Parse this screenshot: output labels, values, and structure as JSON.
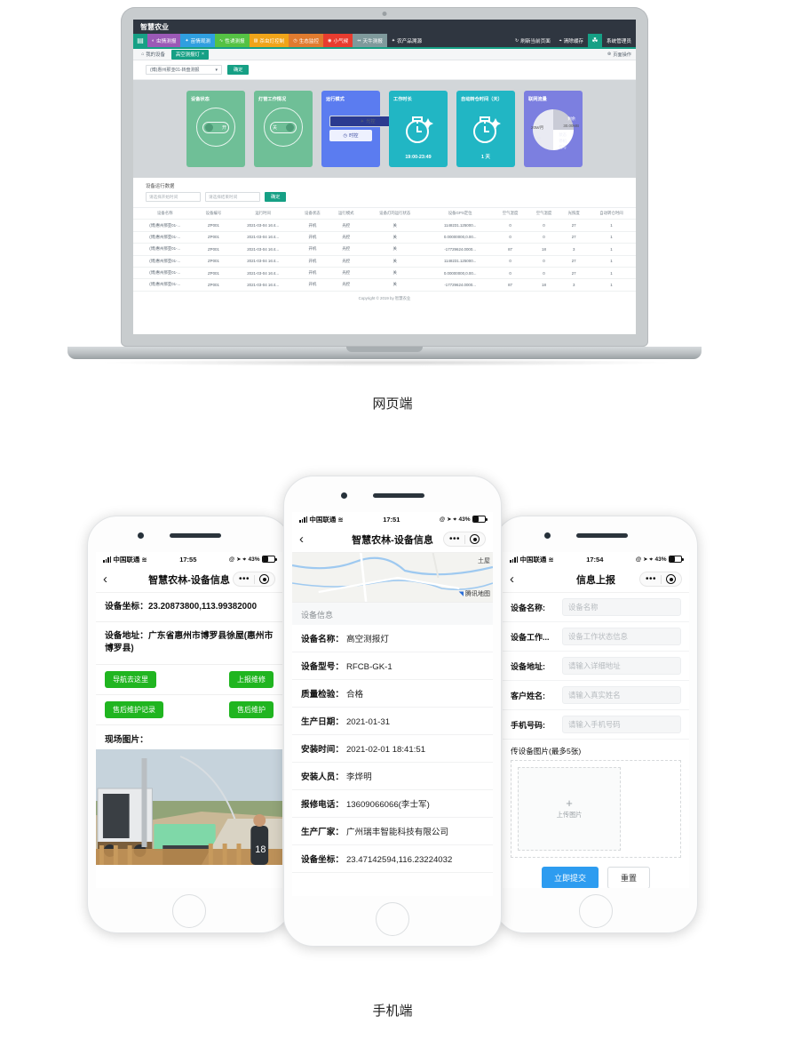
{
  "captions": {
    "web": "网页端",
    "mobile": "手机端"
  },
  "web": {
    "app_title": "智慧农业",
    "home_icon": "grid-icon",
    "nav_items": [
      {
        "label": "虫情测报",
        "icon": "bug-icon",
        "color": "#9b59b6"
      },
      {
        "label": "苗情观测",
        "icon": "leaf-icon",
        "color": "#2f9fe0"
      },
      {
        "label": "性诱测报",
        "icon": "wave-icon",
        "color": "#55c244"
      },
      {
        "label": "杀虫灯控制",
        "icon": "lamp-icon",
        "color": "#f0a419"
      },
      {
        "label": "生态监控",
        "icon": "clock-icon",
        "color": "#e07b2f"
      },
      {
        "label": "小气候",
        "icon": "target-icon",
        "color": "#e83c2f"
      },
      {
        "label": "天牛测报",
        "icon": "insect-icon",
        "color": "#7f9a9c"
      },
      {
        "label": "农产品溯源",
        "icon": "trace-icon",
        "color": "#2f3640"
      }
    ],
    "nav_right": [
      {
        "label": "刷新当前页面",
        "icon": "refresh-icon"
      },
      {
        "label": "清除缓存",
        "icon": "broom-icon"
      }
    ],
    "account": "系统管理员",
    "account_icon": "user-avatar-icon",
    "tabs": [
      {
        "label": "我的设备",
        "icon": "home-icon",
        "active": false,
        "closable": false
      },
      {
        "label": "高空测报灯",
        "icon": "",
        "active": true,
        "closable": true
      }
    ],
    "tab_right_label": "页面操作",
    "tab_right_icon": "settings-icon",
    "filter": {
      "select_value": "(博)惠州那亚01-转盘测报",
      "select_icon": "chevron-down-icon",
      "confirm_label": "确定"
    },
    "cards": [
      {
        "title": "设备状态",
        "type": "toggle",
        "state": "开",
        "color": "#6fbf97",
        "on": true
      },
      {
        "title": "灯管工作情况",
        "type": "toggle",
        "state": "关",
        "color": "#6fbf97",
        "on": false
      },
      {
        "title": "运行模式",
        "type": "mode",
        "color": "#5b7cf0",
        "options": [
          {
            "label": "光控",
            "icon": "sun-icon",
            "selected": true
          },
          {
            "label": "时控",
            "icon": "clock-icon",
            "selected": false
          }
        ]
      },
      {
        "title": "工作时长",
        "type": "clock",
        "color": "#21b6c4",
        "value": "19:00-23:49",
        "icon": "timer-icon"
      },
      {
        "title": "自动转仓时间（天）",
        "type": "clock",
        "color": "#21b6c4",
        "value": "1 天",
        "icon": "timer-icon"
      },
      {
        "title": "联网流量",
        "type": "pie",
        "color": "#7c7fe0",
        "slices": [
          {
            "label": "剩余",
            "value": "30.00MB"
          },
          {
            "label": "20M/月",
            "value": "40"
          },
          {
            "label": "状态",
            "value": "停机"
          },
          {
            "label": "信号",
            "value": ""
          }
        ]
      }
    ],
    "table_section_title": "设备运行数据",
    "date_from_placeholder": "请选择开始时间",
    "date_to_placeholder": "请选择结束时间",
    "date_confirm": "确定",
    "table": {
      "headers": [
        "设备名称",
        "设备编号",
        "运行时间",
        "设备状态",
        "运行模式",
        "设备灯的运行状态",
        "设备GPS定位",
        "空气湿度",
        "空气温度",
        "光照度",
        "自动转仓时间"
      ],
      "rows": [
        [
          "(博)惠州那亚01-...",
          "ZP001",
          "2021-03-04 16:4...",
          "开机",
          "光控",
          "关",
          "1148231.125000...",
          "0",
          "0",
          "27",
          "1"
        ],
        [
          "(博)惠州那亚01-...",
          "ZP001",
          "2021-03-04 16:4...",
          "开机",
          "光控",
          "关",
          "0.00000000,0.00...",
          "0",
          "0",
          "27",
          "1"
        ],
        [
          "(博)惠州那亚01-...",
          "ZP001",
          "2021-03-04 16:4...",
          "开机",
          "光控",
          "关",
          "-17729624.0000...",
          "87",
          "18",
          "3",
          "1"
        ],
        [
          "(博)惠州那亚01-...",
          "ZP001",
          "2021-03-04 16:4...",
          "开机",
          "光控",
          "关",
          "1148231.125000...",
          "0",
          "0",
          "27",
          "1"
        ],
        [
          "(博)惠州那亚01-...",
          "ZP001",
          "2021-03-04 16:4...",
          "开机",
          "光控",
          "关",
          "0.00000000,0.00...",
          "0",
          "0",
          "27",
          "1"
        ],
        [
          "(博)惠州那亚01-...",
          "ZP001",
          "2021-03-04 16:4...",
          "开机",
          "光控",
          "关",
          "-17729624.0000...",
          "87",
          "18",
          "3",
          "1"
        ]
      ]
    },
    "copyright": "Copyright © 2019 by 智慧农业"
  },
  "phone_left": {
    "status": {
      "carrier": "中国联通",
      "wifi_icon": "wifi-icon",
      "time": "17:55",
      "icons": "@ ➤ ⌖",
      "battery": "43%"
    },
    "nav": {
      "back_icon": "chevron-left-icon",
      "title": "智慧农林-设备信息",
      "more_icon": "more-dots-icon",
      "target_icon": "target-circle-icon"
    },
    "rows": [
      {
        "key": "设备坐标：",
        "value": "23.20873800,113.99382000"
      },
      {
        "key": "设备地址：",
        "value": "广东省惠州市博罗县徐屋(惠州市博罗县)"
      }
    ],
    "buttons": [
      {
        "label": "导航去这里"
      },
      {
        "label": "上报维修"
      },
      {
        "label": "售后维护记录"
      },
      {
        "label": "售后维护"
      }
    ],
    "photo_label": "现场图片：",
    "photo_alt": "设备现场照片"
  },
  "phone_center": {
    "status": {
      "carrier": "中国联通",
      "wifi_icon": "wifi-icon",
      "time": "17:51",
      "icons": "@ ➤ ⌖",
      "battery": "43%"
    },
    "nav": {
      "back_icon": "chevron-left-icon",
      "title": "智慧农林-设备信息",
      "more_icon": "more-dots-icon",
      "target_icon": "target-circle-icon"
    },
    "map": {
      "label": "土屋",
      "brand": "腾讯地图",
      "brand_icon": "compass-icon"
    },
    "section_title": "设备信息",
    "rows": [
      {
        "key": "设备名称：",
        "value": "高空测报灯"
      },
      {
        "key": "设备型号：",
        "value": "RFCB-GK-1"
      },
      {
        "key": "质量检验：",
        "value": "合格"
      },
      {
        "key": "生产日期：",
        "value": "2021-01-31"
      },
      {
        "key": "安装时间：",
        "value": "2021-02-01 18:41:51"
      },
      {
        "key": "安装人员：",
        "value": "李烨明"
      },
      {
        "key": "报修电话：",
        "value": "13609066066(李士军)"
      },
      {
        "key": "生产厂家：",
        "value": "广州瑞丰智能科技有限公司"
      },
      {
        "key": "设备坐标：",
        "value": "23.47142594,116.23224032"
      }
    ]
  },
  "phone_right": {
    "status": {
      "carrier": "中国联通",
      "wifi_icon": "wifi-icon",
      "time": "17:54",
      "icons": "@ ➤ ⌖",
      "battery": "43%"
    },
    "nav": {
      "back_icon": "chevron-left-icon",
      "title": "信息上报",
      "more_icon": "more-dots-icon",
      "target_icon": "target-circle-icon"
    },
    "fields": [
      {
        "label": "设备名称:",
        "placeholder": "设备名称"
      },
      {
        "label": "设备工作...",
        "placeholder": "设备工作状态信息"
      },
      {
        "label": "设备地址:",
        "placeholder": "请输入详细地址"
      },
      {
        "label": "客户姓名:",
        "placeholder": "请输入真实姓名"
      },
      {
        "label": "手机号码:",
        "placeholder": "请输入手机号码"
      }
    ],
    "upload_label": "传设备图片(最多5张)",
    "upload_plus": "+",
    "upload_text": "上传图片",
    "submit_label": "立即提交",
    "reset_label": "重置"
  }
}
